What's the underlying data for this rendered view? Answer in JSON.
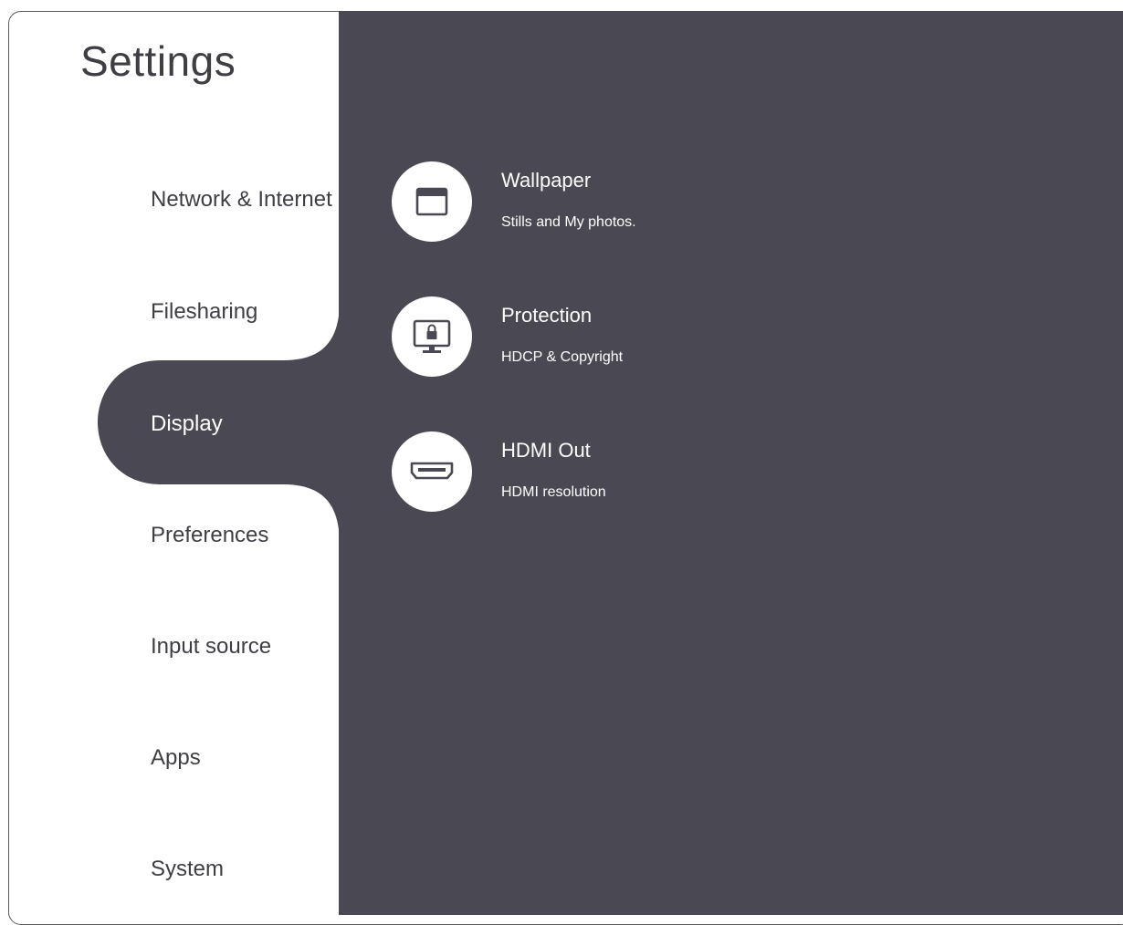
{
  "header": {
    "title": "Settings"
  },
  "sidebar": {
    "items": [
      {
        "label": "Network & Internet",
        "selected": false
      },
      {
        "label": "Filesharing",
        "selected": false
      },
      {
        "label": "Display",
        "selected": true
      },
      {
        "label": "Preferences",
        "selected": false
      },
      {
        "label": "Input source",
        "selected": false
      },
      {
        "label": "Apps",
        "selected": false
      },
      {
        "label": "System",
        "selected": false
      }
    ]
  },
  "main": {
    "tiles": [
      {
        "title": "Wallpaper",
        "subtitle": "Stills and My photos.",
        "icon": "wallpaper-icon"
      },
      {
        "title": "Protection",
        "subtitle": "HDCP & Copyright",
        "icon": "monitor-lock-icon"
      },
      {
        "title": "HDMI Out",
        "subtitle": "HDMI resolution",
        "icon": "hdmi-port-icon"
      }
    ]
  },
  "colors": {
    "panel": "#4a4953",
    "text_dark": "#3e3e44",
    "text_light": "#ffffff"
  }
}
